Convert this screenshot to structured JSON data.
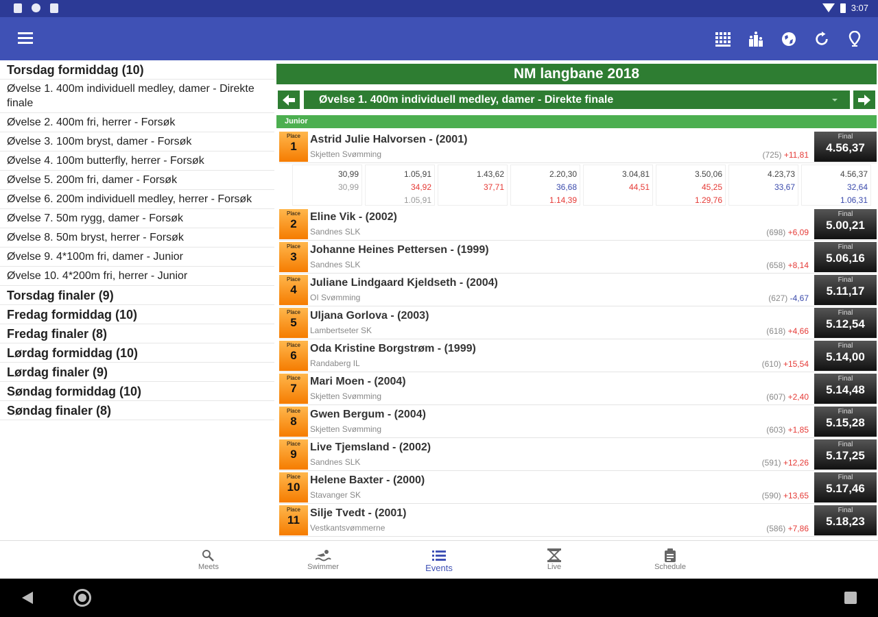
{
  "status_bar": {
    "time": "3:07"
  },
  "app_bar": {
    "actions": [
      "grid-icon",
      "podium-icon",
      "globe-icon",
      "refresh-icon",
      "location-icon"
    ]
  },
  "sidebar": {
    "items": [
      {
        "label": "Torsdag formiddag (10)",
        "group": true
      },
      {
        "label": "Øvelse 1. 400m individuell medley, damer - Direkte finale",
        "group": false
      },
      {
        "label": "Øvelse 2. 400m fri, herrer - Forsøk",
        "group": false
      },
      {
        "label": "Øvelse 3. 100m bryst, damer - Forsøk",
        "group": false
      },
      {
        "label": "Øvelse 4. 100m butterfly, herrer - Forsøk",
        "group": false
      },
      {
        "label": "Øvelse 5. 200m fri, damer - Forsøk",
        "group": false
      },
      {
        "label": "Øvelse 6. 200m individuell medley, herrer - Forsøk",
        "group": false
      },
      {
        "label": "Øvelse 7. 50m rygg, damer - Forsøk",
        "group": false
      },
      {
        "label": "Øvelse 8. 50m bryst, herrer - Forsøk",
        "group": false
      },
      {
        "label": "Øvelse 9. 4*100m fri, damer - Junior",
        "group": false
      },
      {
        "label": "Øvelse 10. 4*200m fri, herrer - Junior",
        "group": false
      },
      {
        "label": "Torsdag finaler (9)",
        "group": true
      },
      {
        "label": "Fredag formiddag (10)",
        "group": true
      },
      {
        "label": "Fredag finaler (8)",
        "group": true
      },
      {
        "label": "Lørdag formiddag (10)",
        "group": true
      },
      {
        "label": "Lørdag finaler (9)",
        "group": true
      },
      {
        "label": "Søndag formiddag (10)",
        "group": true
      },
      {
        "label": "Søndag finaler (8)",
        "group": true
      }
    ]
  },
  "main": {
    "meet_title": "NM langbane 2018",
    "event_label": "Øvelse 1. 400m individuell medley, damer - Direkte finale",
    "category": "Junior",
    "place_label": "Place",
    "final_label": "Final",
    "results": [
      {
        "place": "1",
        "name": "Astrid Julie Halvorsen - (2001)",
        "club": "Skjetten Svømming",
        "points": "(725)",
        "diff": "+11,81",
        "diff_type": "plus",
        "time": "4.56,37"
      },
      {
        "place": "2",
        "name": "Eline Vik - (2002)",
        "club": "Sandnes SLK",
        "points": "(698)",
        "diff": "+6,09",
        "diff_type": "plus",
        "time": "5.00,21"
      },
      {
        "place": "3",
        "name": "Johanne Heines Pettersen - (1999)",
        "club": "Sandnes SLK",
        "points": "(658)",
        "diff": "+8,14",
        "diff_type": "plus",
        "time": "5.06,16"
      },
      {
        "place": "4",
        "name": "Juliane Lindgaard Kjeldseth - (2004)",
        "club": "OI Svømming",
        "points": "(627)",
        "diff": "-4,67",
        "diff_type": "minus",
        "time": "5.11,17"
      },
      {
        "place": "5",
        "name": "Uljana Gorlova - (2003)",
        "club": "Lambertseter SK",
        "points": "(618)",
        "diff": "+4,66",
        "diff_type": "plus",
        "time": "5.12,54"
      },
      {
        "place": "6",
        "name": "Oda Kristine Borgstrøm - (1999)",
        "club": "Randaberg IL",
        "points": "(610)",
        "diff": "+15,54",
        "diff_type": "plus",
        "time": "5.14,00"
      },
      {
        "place": "7",
        "name": "Mari Moen - (2004)",
        "club": "Skjetten Svømming",
        "points": "(607)",
        "diff": "+2,40",
        "diff_type": "plus",
        "time": "5.14,48"
      },
      {
        "place": "8",
        "name": "Gwen Bergum - (2004)",
        "club": "Skjetten Svømming",
        "points": "(603)",
        "diff": "+1,85",
        "diff_type": "plus",
        "time": "5.15,28"
      },
      {
        "place": "9",
        "name": "Live Tjemsland - (2002)",
        "club": "Sandnes SLK",
        "points": "(591)",
        "diff": "+12,26",
        "diff_type": "plus",
        "time": "5.17,25"
      },
      {
        "place": "10",
        "name": "Helene Baxter - (2000)",
        "club": "Stavanger SK",
        "points": "(590)",
        "diff": "+13,65",
        "diff_type": "plus",
        "time": "5.17,46"
      },
      {
        "place": "11",
        "name": "Silje Tvedt - (2001)",
        "club": "Vestkantsvømmerne",
        "points": "(586)",
        "diff": "+7,86",
        "diff_type": "plus",
        "time": "5.18,23"
      }
    ],
    "splits": [
      {
        "cum": "30,99",
        "lap": "30,99",
        "lap_type": "plain",
        "third": "",
        "third_type": "plain"
      },
      {
        "cum": "1.05,91",
        "lap": "34,92",
        "lap_type": "red",
        "third": "1.05,91",
        "third_type": "plain"
      },
      {
        "cum": "1.43,62",
        "lap": "37,71",
        "lap_type": "red",
        "third": "",
        "third_type": "plain"
      },
      {
        "cum": "2.20,30",
        "lap": "36,68",
        "lap_type": "blue",
        "third": "1.14,39",
        "third_type": "red"
      },
      {
        "cum": "3.04,81",
        "lap": "44,51",
        "lap_type": "red",
        "third": "",
        "third_type": "plain"
      },
      {
        "cum": "3.50,06",
        "lap": "45,25",
        "lap_type": "red",
        "third": "1.29,76",
        "third_type": "red"
      },
      {
        "cum": "4.23,73",
        "lap": "33,67",
        "lap_type": "blue",
        "third": "",
        "third_type": "plain"
      },
      {
        "cum": "4.56,37",
        "lap": "32,64",
        "lap_type": "blue",
        "third": "1.06,31",
        "third_type": "blue"
      }
    ]
  },
  "bottom_nav": {
    "tabs": [
      {
        "label": "Meets",
        "icon": "meets-icon",
        "active": false
      },
      {
        "label": "Swimmer",
        "icon": "swimmer-icon",
        "active": false
      },
      {
        "label": "Events",
        "icon": "list-icon",
        "active": true
      },
      {
        "label": "Live",
        "icon": "hourglass-icon",
        "active": false
      },
      {
        "label": "Schedule",
        "icon": "clipboard-icon",
        "active": false
      }
    ]
  }
}
